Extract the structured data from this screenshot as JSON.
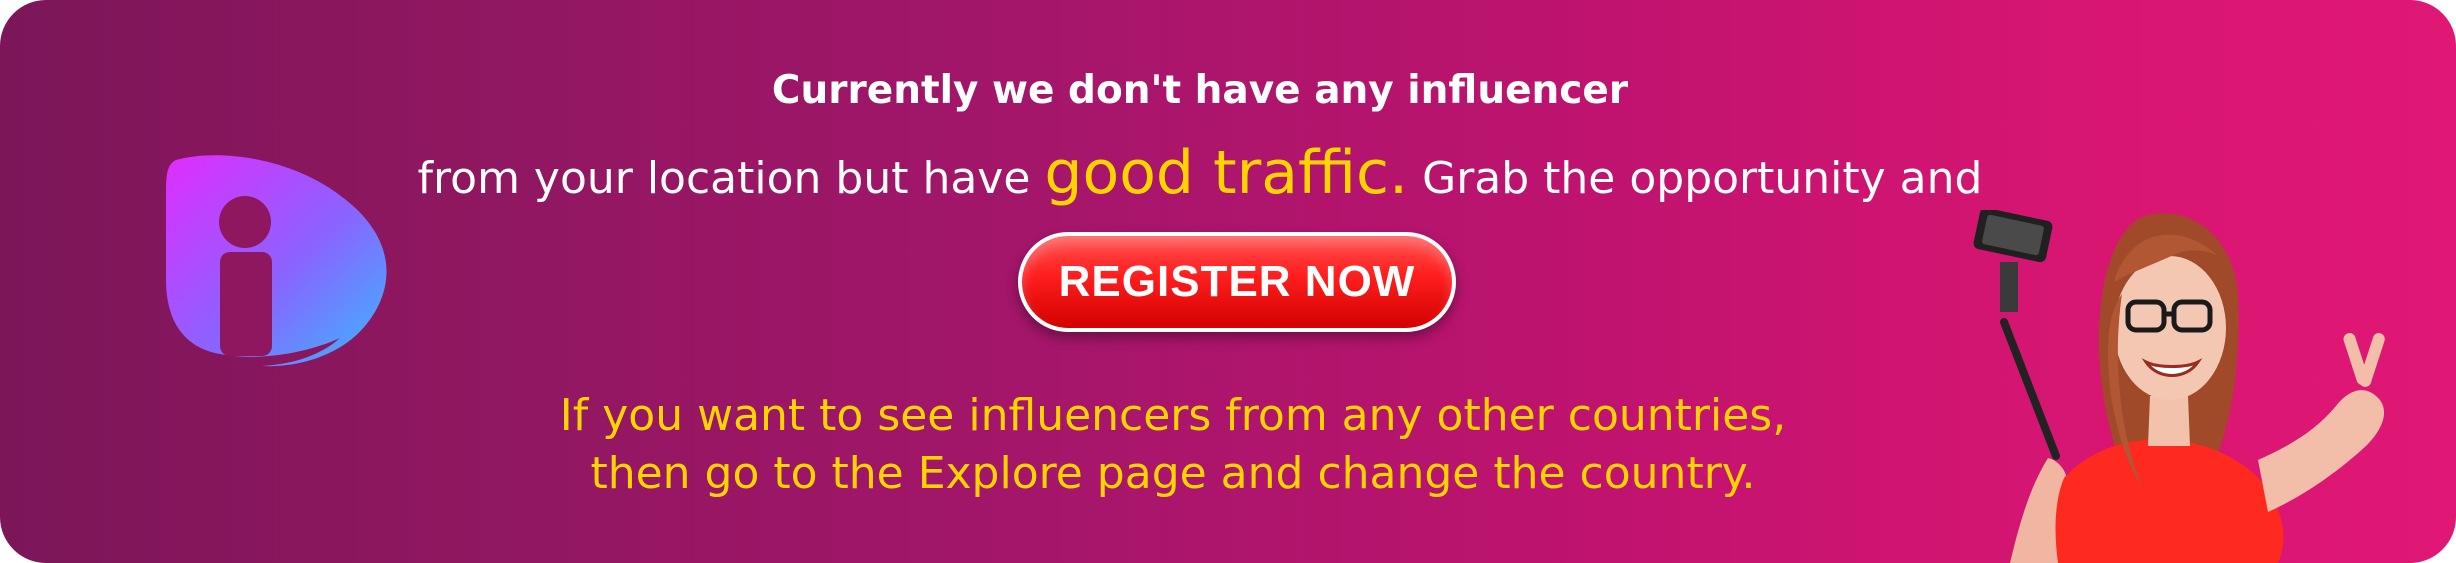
{
  "banner": {
    "line1": "Currently we don't have any influencer",
    "line2_part1": "from your location but have ",
    "line2_highlight": "good traffic.",
    "line2_part2": " Grab the opportunity and",
    "register_label": "REGISTER NOW",
    "note_line1": "If you want to see influencers from any other countries,",
    "note_line2": "then go to the Explore page and change the country."
  },
  "icons": {
    "logo": "brand-logo-icon",
    "person": "selfie-person-illustration"
  },
  "colors": {
    "gradient_start": "#7c1659",
    "gradient_end": "#e01775",
    "highlight": "#ffd400",
    "button": "#ff1f1f"
  }
}
